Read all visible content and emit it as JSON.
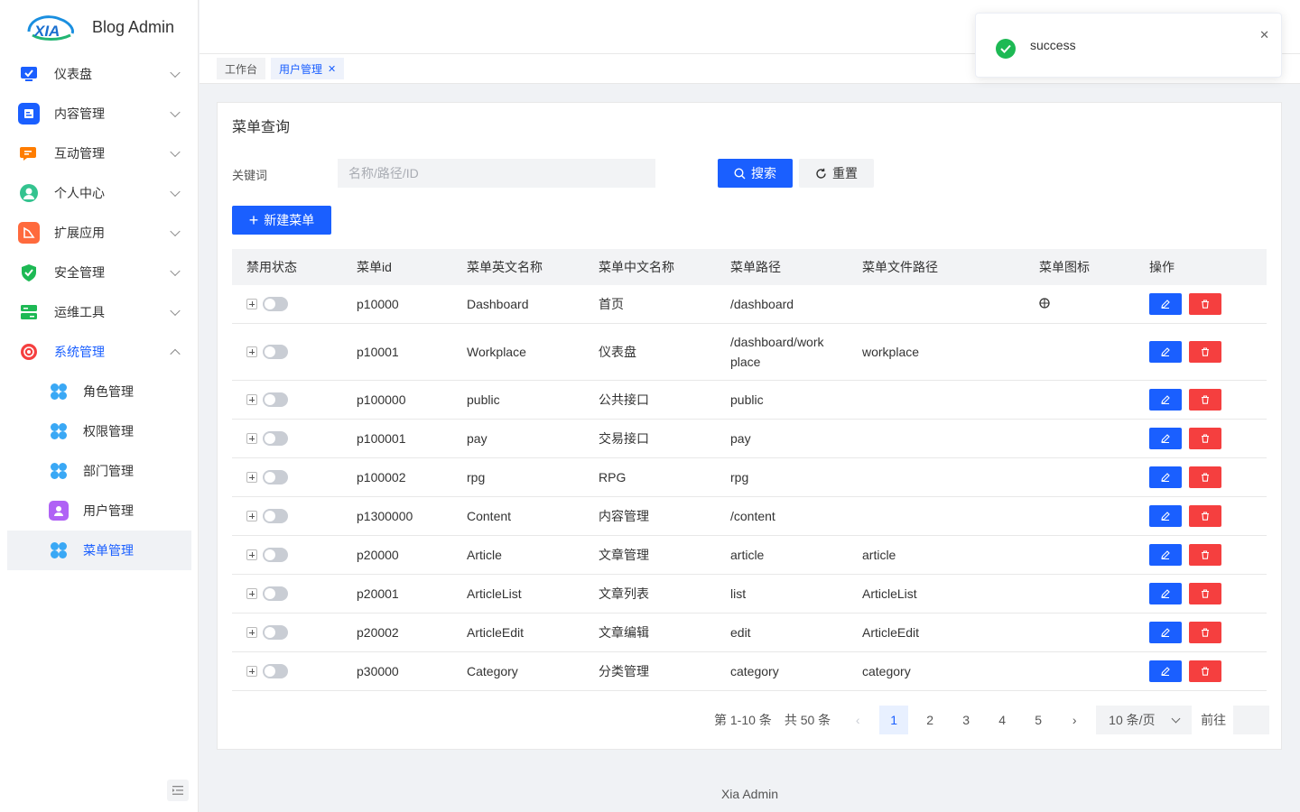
{
  "app": {
    "title": "Blog Admin",
    "logo_text": "XIA"
  },
  "sidebar": {
    "items": [
      {
        "label": "仪表盘",
        "icon": "monitor-icon",
        "color": "#1a5fff",
        "expanded": false
      },
      {
        "label": "内容管理",
        "icon": "document-icon",
        "color": "#1a5fff",
        "expanded": false
      },
      {
        "label": "互动管理",
        "icon": "chat-icon",
        "color": "#ff7d00",
        "expanded": false
      },
      {
        "label": "个人中心",
        "icon": "user-icon",
        "color": "#34c38f",
        "expanded": false
      },
      {
        "label": "扩展应用",
        "icon": "extension-icon",
        "color": "#ff6a3d",
        "expanded": false
      },
      {
        "label": "安全管理",
        "icon": "shield-icon",
        "color": "#1db954",
        "expanded": false
      },
      {
        "label": "运维工具",
        "icon": "tools-icon",
        "color": "#1db954",
        "expanded": false
      },
      {
        "label": "系统管理",
        "icon": "settings-icon",
        "color": "#f53f3f",
        "expanded": true
      }
    ],
    "sub_items": [
      {
        "label": "角色管理",
        "icon": "flower-icon"
      },
      {
        "label": "权限管理",
        "icon": "flower-icon"
      },
      {
        "label": "部门管理",
        "icon": "flower-icon"
      },
      {
        "label": "用户管理",
        "icon": "user-badge-icon"
      },
      {
        "label": "菜单管理",
        "icon": "flower-icon",
        "selected": true
      }
    ]
  },
  "tabs": [
    {
      "label": "工作台"
    },
    {
      "label": "用户管理",
      "active": true
    }
  ],
  "notification": {
    "message": "success"
  },
  "card": {
    "title": "菜单查询",
    "keyword_label": "关键词",
    "keyword_placeholder": "名称/路径/ID",
    "search_label": "搜索",
    "reset_label": "重置",
    "new_label": "新建菜单"
  },
  "table": {
    "columns": [
      "禁用状态",
      "菜单id",
      "菜单英文名称",
      "菜单中文名称",
      "菜单路径",
      "菜单文件路径",
      "菜单图标",
      "操作"
    ],
    "rows": [
      {
        "id": "p10000",
        "en": "Dashboard",
        "zh": "首页",
        "path": "/dashboard",
        "file": "",
        "icon": "bug-icon"
      },
      {
        "id": "p10001",
        "en": "Workplace",
        "zh": "仪表盘",
        "path": "/dashboard/workplace",
        "file": "workplace",
        "icon": ""
      },
      {
        "id": "p100000",
        "en": "public",
        "zh": "公共接口",
        "path": "public",
        "file": "",
        "icon": ""
      },
      {
        "id": "p100001",
        "en": "pay",
        "zh": "交易接口",
        "path": "pay",
        "file": "",
        "icon": ""
      },
      {
        "id": "p100002",
        "en": "rpg",
        "zh": "RPG",
        "path": "rpg",
        "file": "",
        "icon": ""
      },
      {
        "id": "p1300000",
        "en": "Content",
        "zh": "内容管理",
        "path": "/content",
        "file": "",
        "icon": ""
      },
      {
        "id": "p20000",
        "en": "Article",
        "zh": "文章管理",
        "path": "article",
        "file": "article",
        "icon": ""
      },
      {
        "id": "p20001",
        "en": "ArticleList",
        "zh": "文章列表",
        "path": "list",
        "file": "ArticleList",
        "icon": ""
      },
      {
        "id": "p20002",
        "en": "ArticleEdit",
        "zh": "文章编辑",
        "path": "edit",
        "file": "ArticleEdit",
        "icon": ""
      },
      {
        "id": "p30000",
        "en": "Category",
        "zh": "分类管理",
        "path": "category",
        "file": "category",
        "icon": ""
      }
    ]
  },
  "pagination": {
    "range_text": "第 1-10 条",
    "total_text": "共 50 条",
    "pages": [
      "1",
      "2",
      "3",
      "4",
      "5"
    ],
    "current": "1",
    "page_size": "10 条/页",
    "goto_label": "前往"
  },
  "footer": {
    "text": "Xia Admin"
  },
  "colors": {
    "primary": "#1a5fff",
    "danger": "#f53f3f",
    "success": "#1db954"
  }
}
